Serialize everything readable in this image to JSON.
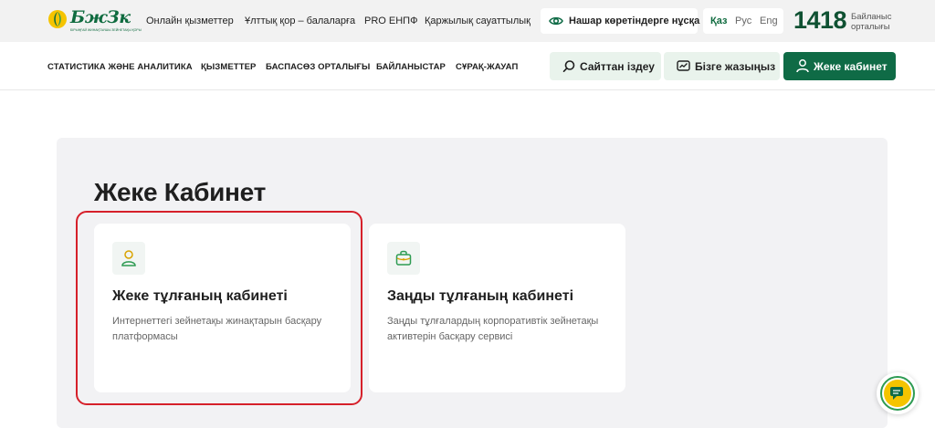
{
  "topbar": {
    "logo_text": "БжЗк",
    "logo_tagline": "БІРЫҢҒАЙ ЖИНАҚТАУШЫ ЗЕЙНЕТАҚЫ ҚОРЫ",
    "links": [
      "Онлайн қызметтер",
      "Ұлттық қор – балаларға",
      "PRO ЕНПФ",
      "Қаржылық сауаттылық"
    ],
    "accessibility_label": "Нашар көретіндерге нұсқа",
    "languages": [
      {
        "label": "Қаз",
        "active": true
      },
      {
        "label": "Рус",
        "active": false
      },
      {
        "label": "Eng",
        "active": false
      }
    ],
    "hotline_number": "1418",
    "hotline_label": "Байланыс орталығы"
  },
  "nav": {
    "links": [
      "СТАТИСТИКА ЖӘНЕ АНАЛИТИКА",
      "ҚЫЗМЕТТЕР",
      "БАСПАСӨЗ ОРТАЛЫҒЫ",
      "БАЙЛАНЫСТАР",
      "СҰРАҚ-ЖАУАП"
    ],
    "search_label": "Сайттан іздеу",
    "write_label": "Бізге жазыңыз",
    "cabinet_label": "Жеке кабинет"
  },
  "main": {
    "title": "Жеке Кабинет",
    "cards": [
      {
        "title": "Жеке тұлғаның кабинеті",
        "description": "Интернеттегі зейнетақы жинақтарын басқару платформасы",
        "icon": "user-icon"
      },
      {
        "title": "Заңды тұлғаның кабинеті",
        "description": "Заңды тұлғалардың корпоративтік зейнетақы активтерін басқару сервисі",
        "icon": "briefcase-icon"
      }
    ]
  },
  "colors": {
    "brand_green": "#0f6b46",
    "light_green": "#e9f3ec",
    "highlight_red": "#d6202a",
    "chat_yellow": "#f5c400"
  }
}
